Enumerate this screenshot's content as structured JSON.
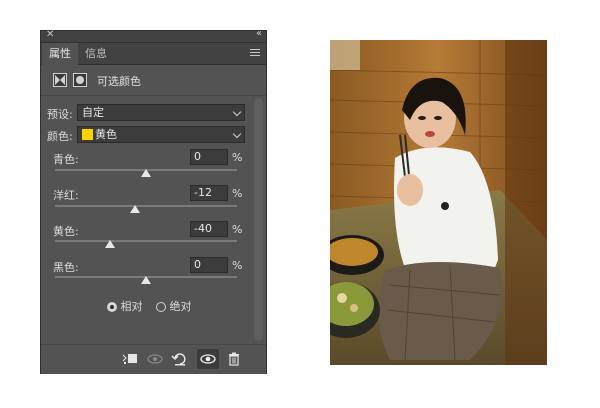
{
  "panel": {
    "tabs": [
      {
        "label": "属性"
      },
      {
        "label": "信息"
      }
    ],
    "title": "可选颜色",
    "preset": {
      "label": "预设:",
      "value": "自定"
    },
    "color": {
      "label": "颜色:",
      "value": "黄色",
      "swatch": "#ffd200"
    },
    "sliders": [
      {
        "label": "青色:",
        "value": "0",
        "unit": "%",
        "level": 0
      },
      {
        "label": "洋红:",
        "value": "-12",
        "unit": "%",
        "level": -12
      },
      {
        "label": "黄色:",
        "value": "-40",
        "unit": "%",
        "level": -40
      },
      {
        "label": "黑色:",
        "value": "0",
        "unit": "%",
        "level": 0
      }
    ],
    "method": {
      "options": [
        {
          "label": "相对",
          "selected": true
        },
        {
          "label": "绝对",
          "selected": false
        }
      ]
    },
    "bottom_icons": [
      "clip-to-layer-icon",
      "view-previous-icon",
      "reset-icon",
      "visibility-icon",
      "delete-icon"
    ]
  },
  "photo": {
    "subject": "photograph"
  }
}
